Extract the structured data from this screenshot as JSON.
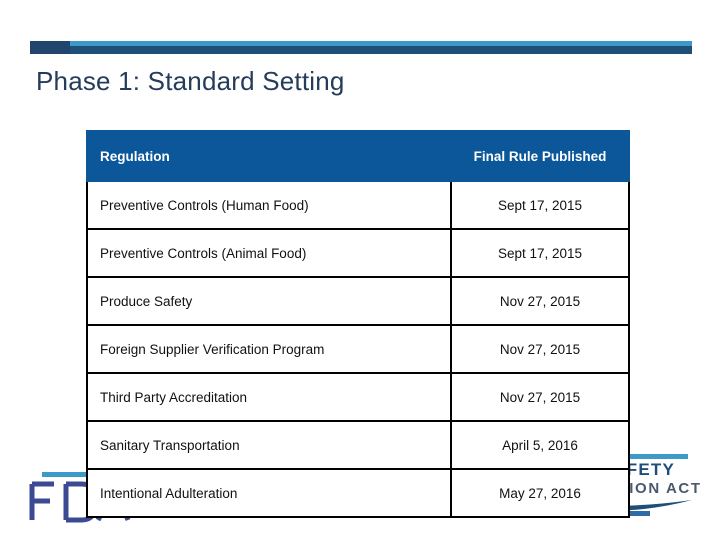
{
  "slide": {
    "title": "Phase 1: Standard Setting",
    "accent_light": "#3d9ac8",
    "accent_dark": "#1f4e79",
    "title_color": "#253c5a",
    "table_header_color": "#0b5799"
  },
  "table": {
    "columns": [
      "Regulation",
      "Final Rule Published"
    ],
    "rows": [
      {
        "regulation": "Preventive Controls (Human Food)",
        "final_rule_published": "Sept 17, 2015"
      },
      {
        "regulation": "Preventive Controls (Animal Food)",
        "final_rule_published": "Sept 17, 2015"
      },
      {
        "regulation": "Produce Safety",
        "final_rule_published": "Nov 27, 2015"
      },
      {
        "regulation": "Foreign Supplier Verification Program",
        "final_rule_published": "Nov 27, 2015"
      },
      {
        "regulation": "Third Party Accreditation",
        "final_rule_published": "Nov 27, 2015"
      },
      {
        "regulation": "Sanitary Transportation",
        "final_rule_published": "April 5, 2016"
      },
      {
        "regulation": "Intentional Adulteration",
        "final_rule_published": "May 27, 2016"
      }
    ]
  },
  "logos": {
    "fda": {
      "name": "fda-logo",
      "text": "FDA"
    },
    "fsma": {
      "name": "fsma-logo",
      "line1": "FOOD SAFETY",
      "line2": "MODERNIZATION ACT"
    }
  }
}
